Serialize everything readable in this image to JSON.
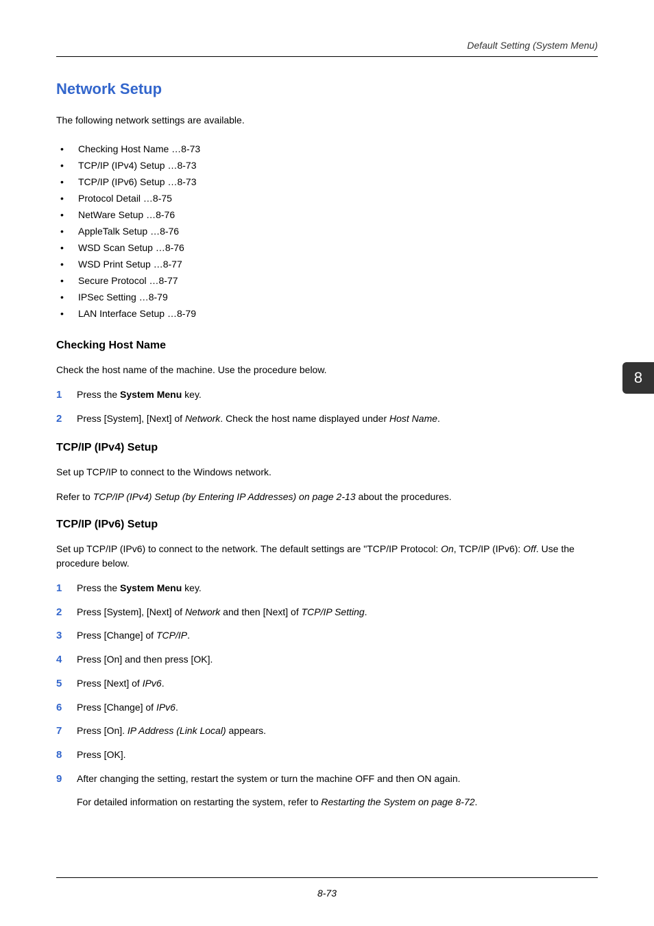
{
  "breadcrumb": "Default Setting (System Menu)",
  "h1": "Network Setup",
  "intro": "The following network settings are available.",
  "bullets": [
    "Checking Host Name …8-73",
    "TCP/IP (IPv4) Setup …8-73",
    "TCP/IP (IPv6) Setup …8-73",
    "Protocol Detail …8-75",
    "NetWare Setup …8-76",
    "AppleTalk Setup …8-76",
    "WSD Scan Setup …8-76",
    "WSD Print Setup …8-77",
    "Secure Protocol …8-77",
    "IPSec Setting …8-79",
    "LAN Interface Setup …8-79"
  ],
  "section1": {
    "title": "Checking Host Name",
    "para": "Check the host name of the machine. Use the procedure below.",
    "steps": {
      "s1_a": "Press the ",
      "s1_b": "System Menu",
      "s1_c": " key.",
      "s2_a": "Press [System], [Next] of ",
      "s2_b": "Network",
      "s2_c": ". Check the host name displayed under ",
      "s2_d": "Host Name",
      "s2_e": "."
    }
  },
  "section2": {
    "title": "TCP/IP (IPv4) Setup",
    "para1": "Set up TCP/IP to connect to the Windows network.",
    "para2_a": "Refer to ",
    "para2_b": "TCP/IP (IPv4) Setup (by Entering IP Addresses) on page 2-13",
    "para2_c": " about the procedures."
  },
  "section3": {
    "title": "TCP/IP (IPv6) Setup",
    "para_a": "Set up TCP/IP (IPv6) to connect to the network. The default settings are \"TCP/IP Protocol: ",
    "para_b": "On",
    "para_c": ", TCP/IP (IPv6): ",
    "para_d": "Off",
    "para_e": ". Use the procedure below.",
    "steps": {
      "s1_a": "Press the ",
      "s1_b": "System Menu",
      "s1_c": " key.",
      "s2_a": "Press [System], [Next] of ",
      "s2_b": "Network",
      "s2_c": " and then [Next] of ",
      "s2_d": "TCP/IP Setting",
      "s2_e": ".",
      "s3_a": "Press [Change] of ",
      "s3_b": "TCP/IP",
      "s3_c": ".",
      "s4": "Press [On] and then press [OK].",
      "s5_a": "Press [Next] of ",
      "s5_b": "IPv6",
      "s5_c": ".",
      "s6_a": "Press [Change] of ",
      "s6_b": "IPv6",
      "s6_c": ".",
      "s7_a": "Press [On]. ",
      "s7_b": "IP Address (Link Local)",
      "s7_c": " appears.",
      "s8": "Press [OK].",
      "s9": "After changing the setting, restart the system or turn the machine OFF and then ON again.",
      "s9_follow_a": "For detailed information on restarting the system, refer to ",
      "s9_follow_b": "Restarting the System on page 8-72",
      "s9_follow_c": "."
    }
  },
  "step_numbers": [
    "1",
    "2",
    "3",
    "4",
    "5",
    "6",
    "7",
    "8",
    "9"
  ],
  "sidetab": "8",
  "pagenum": "8-73"
}
